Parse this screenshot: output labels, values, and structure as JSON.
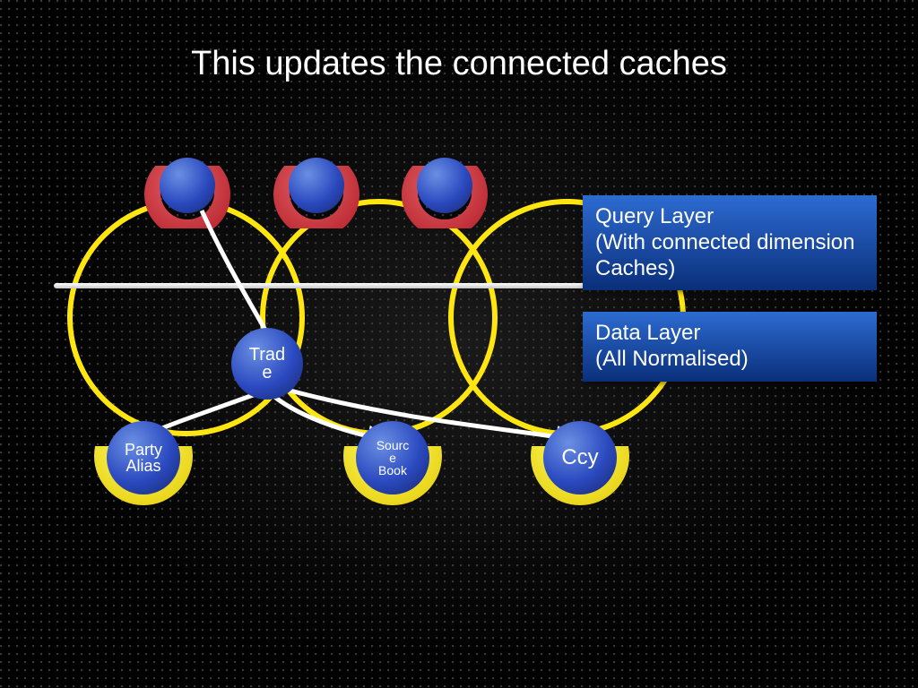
{
  "title": "This updates the connected caches",
  "layers": {
    "query": "Query Layer\n(With connected dimension Caches)",
    "data": "Data Layer\n(All Normalised)"
  },
  "nodes": {
    "trade": "Trad\ne",
    "party": "Party\nAlias",
    "source": "Sourc\ne\nBook",
    "ccy": "Ccy"
  }
}
